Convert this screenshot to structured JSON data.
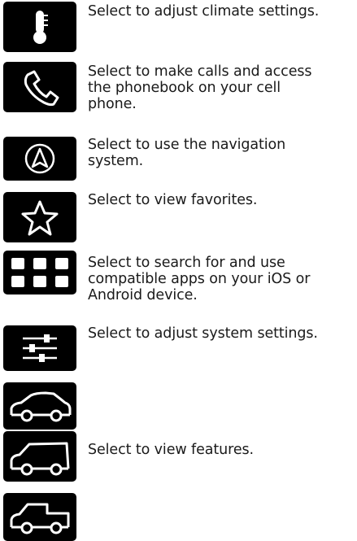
{
  "rows": [
    {
      "icon": "thermometer-icon",
      "text_lines": [
        "Select to adjust climate settings."
      ]
    },
    {
      "icon": "phone-icon",
      "text_lines": [
        "Select to make calls and access",
        "the phonebook on your cell",
        "phone."
      ]
    },
    {
      "icon": "navigation-icon",
      "text_lines": [
        "Select to use the navigation",
        "system."
      ]
    },
    {
      "icon": "star-icon",
      "text_lines": [
        "Select to view favorites."
      ]
    },
    {
      "icon": "apps-grid-icon",
      "text_lines": [
        "Select to search for and use",
        "compatible apps on your iOS or",
        "Android device."
      ]
    },
    {
      "icon": "settings-sliders-icon",
      "text_lines": [
        "Select to adjust system settings."
      ]
    },
    {
      "icon": "car-sedan-icon",
      "text_lines": []
    },
    {
      "icon": "car-suv-icon",
      "text_lines": [
        "Select to view features."
      ]
    },
    {
      "icon": "car-truck-icon",
      "text_lines": []
    }
  ]
}
